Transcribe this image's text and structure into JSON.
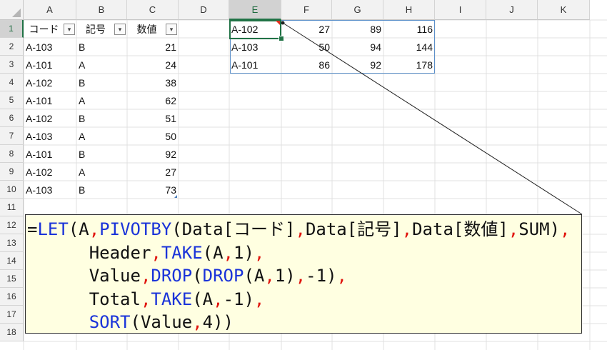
{
  "columns": [
    "A",
    "B",
    "C",
    "D",
    "E",
    "F",
    "G",
    "H",
    "I",
    "J",
    "K"
  ],
  "selected_column": "E",
  "rows": [
    "1",
    "2",
    "3",
    "4",
    "5",
    "6",
    "7",
    "8",
    "9",
    "10",
    "11",
    "12",
    "13",
    "14",
    "15",
    "16",
    "17",
    "18"
  ],
  "selected_row": "1",
  "table": {
    "headers": [
      "コード",
      "記号",
      "数値"
    ],
    "data": [
      [
        "A-103",
        "B",
        "21"
      ],
      [
        "A-101",
        "A",
        "24"
      ],
      [
        "A-102",
        "B",
        "38"
      ],
      [
        "A-101",
        "A",
        "62"
      ],
      [
        "A-102",
        "B",
        "51"
      ],
      [
        "A-103",
        "A",
        "50"
      ],
      [
        "A-101",
        "B",
        "92"
      ],
      [
        "A-102",
        "A",
        "27"
      ],
      [
        "A-103",
        "B",
        "73"
      ]
    ]
  },
  "result": [
    [
      "A-102",
      "27",
      "89",
      "116"
    ],
    [
      "A-103",
      "50",
      "94",
      "144"
    ],
    [
      "A-101",
      "86",
      "92",
      "178"
    ]
  ],
  "formula_tokens": [
    [
      [
        "=",
        "tx"
      ],
      [
        "LET",
        "fn"
      ],
      [
        "(A",
        "tx"
      ],
      [
        ",",
        "comma"
      ],
      [
        "PIVOTBY",
        "fn"
      ],
      [
        "(Data[コード]",
        "tx"
      ],
      [
        ",",
        "comma"
      ],
      [
        "Data[記号]",
        "tx"
      ],
      [
        ",",
        "comma"
      ],
      [
        "Data[数値]",
        "tx"
      ],
      [
        ",",
        "comma"
      ],
      [
        "SUM)",
        "tx"
      ],
      [
        ",",
        "comma"
      ]
    ],
    [
      [
        "      Header",
        "tx"
      ],
      [
        ",",
        "comma"
      ],
      [
        "TAKE",
        "fn"
      ],
      [
        "(A",
        "tx"
      ],
      [
        ",",
        "comma"
      ],
      [
        "1)",
        "tx"
      ],
      [
        ",",
        "comma"
      ]
    ],
    [
      [
        "      Value",
        "tx"
      ],
      [
        ",",
        "comma"
      ],
      [
        "DROP",
        "fn"
      ],
      [
        "(",
        "tx"
      ],
      [
        "DROP",
        "fn"
      ],
      [
        "(A",
        "tx"
      ],
      [
        ",",
        "comma"
      ],
      [
        "1)",
        "tx"
      ],
      [
        ",",
        "comma"
      ],
      [
        "-1)",
        "tx"
      ],
      [
        ",",
        "comma"
      ]
    ],
    [
      [
        "      Total",
        "tx"
      ],
      [
        ",",
        "comma"
      ],
      [
        "TAKE",
        "fn"
      ],
      [
        "(A",
        "tx"
      ],
      [
        ",",
        "comma"
      ],
      [
        "-1)",
        "tx"
      ],
      [
        ",",
        "comma"
      ]
    ],
    [
      [
        "      ",
        "tx"
      ],
      [
        "SORT",
        "fn"
      ],
      [
        "(Value",
        "tx"
      ],
      [
        ",",
        "comma"
      ],
      [
        "4))",
        "tx"
      ]
    ]
  ],
  "colors": {
    "accent": "#217346",
    "function": "#1a33d9",
    "separator": "#e0140c",
    "comment_bg": "#ffffe1",
    "result_border": "#5b8fc9"
  },
  "icons": {
    "filter": "filter-dropdown-icon"
  }
}
